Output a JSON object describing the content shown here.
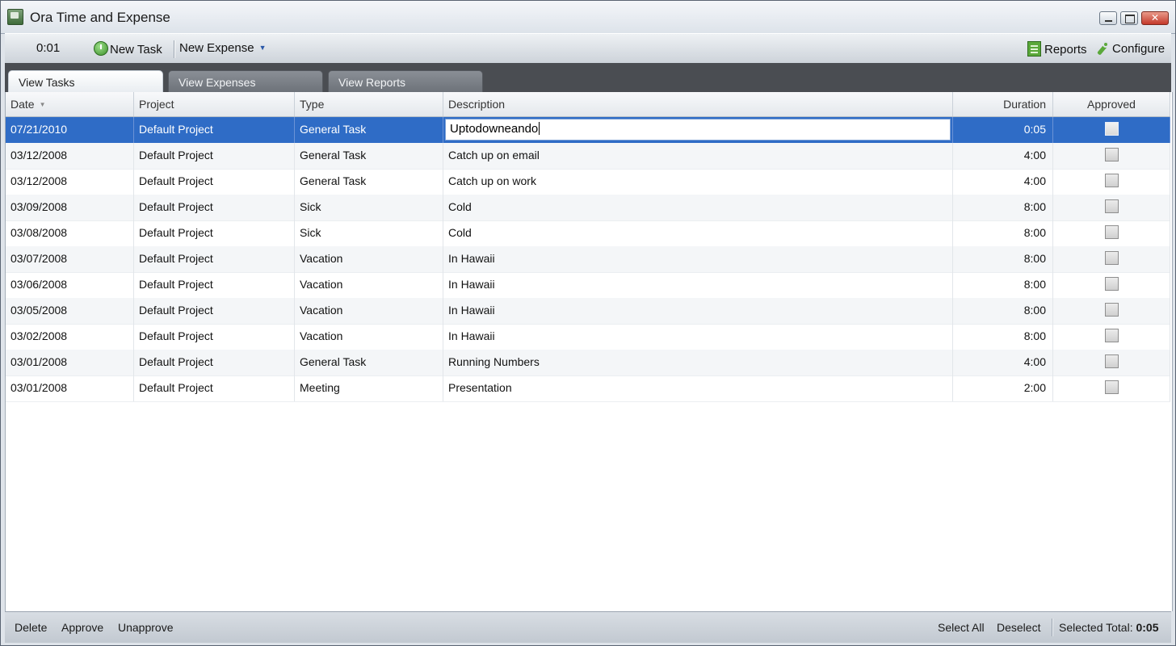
{
  "window": {
    "title": "Ora Time and Expense",
    "controls": {
      "minimize_icon": "minimize-icon",
      "maximize_icon": "maximize-icon",
      "close_icon": "close-icon"
    }
  },
  "toolbar": {
    "timer": "0:01",
    "new_task": "New Task",
    "new_expense": "New Expense",
    "reports": "Reports",
    "configure": "Configure"
  },
  "tabs": [
    {
      "label": "View Tasks",
      "active": true
    },
    {
      "label": "View Expenses",
      "active": false
    },
    {
      "label": "View Reports",
      "active": false
    }
  ],
  "grid": {
    "columns": [
      "Date",
      "Project",
      "Type",
      "Description",
      "Duration",
      "Approved"
    ],
    "sorted_by": "Date",
    "editing_value": "Uptodowneando",
    "rows": [
      {
        "date": "07/21/2010",
        "project": "Default Project",
        "type": "General Task",
        "description": "Uptodowneando",
        "duration": "0:05",
        "approved": false,
        "selected": true
      },
      {
        "date": "03/12/2008",
        "project": "Default Project",
        "type": "General Task",
        "description": "Catch up on email",
        "duration": "4:00",
        "approved": false
      },
      {
        "date": "03/12/2008",
        "project": "Default Project",
        "type": "General Task",
        "description": "Catch up on work",
        "duration": "4:00",
        "approved": false
      },
      {
        "date": "03/09/2008",
        "project": "Default Project",
        "type": "Sick",
        "description": "Cold",
        "duration": "8:00",
        "approved": false
      },
      {
        "date": "03/08/2008",
        "project": "Default Project",
        "type": "Sick",
        "description": "Cold",
        "duration": "8:00",
        "approved": false
      },
      {
        "date": "03/07/2008",
        "project": "Default Project",
        "type": "Vacation",
        "description": "In Hawaii",
        "duration": "8:00",
        "approved": false
      },
      {
        "date": "03/06/2008",
        "project": "Default Project",
        "type": "Vacation",
        "description": "In Hawaii",
        "duration": "8:00",
        "approved": false
      },
      {
        "date": "03/05/2008",
        "project": "Default Project",
        "type": "Vacation",
        "description": "In Hawaii",
        "duration": "8:00",
        "approved": false
      },
      {
        "date": "03/02/2008",
        "project": "Default Project",
        "type": "Vacation",
        "description": "In Hawaii",
        "duration": "8:00",
        "approved": false
      },
      {
        "date": "03/01/2008",
        "project": "Default Project",
        "type": "General Task",
        "description": "Running Numbers",
        "duration": "4:00",
        "approved": false
      },
      {
        "date": "03/01/2008",
        "project": "Default Project",
        "type": "Meeting",
        "description": "Presentation",
        "duration": "2:00",
        "approved": false
      }
    ]
  },
  "bottombar": {
    "delete": "Delete",
    "approve": "Approve",
    "unapprove": "Unapprove",
    "select_all": "Select All",
    "deselect": "Deselect",
    "selected_total_label": "Selected Total:",
    "selected_total_value": "0:05"
  },
  "colors": {
    "selection": "#2f6cc6",
    "accent_green": "#5aa83a",
    "tabstrip": "#4a4d52"
  }
}
